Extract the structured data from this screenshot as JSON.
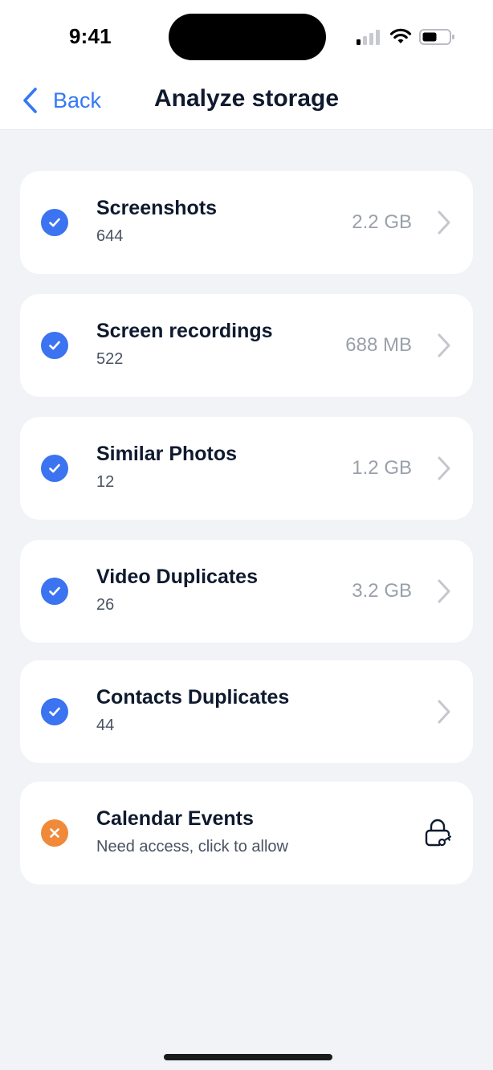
{
  "status_bar": {
    "time": "9:41"
  },
  "nav": {
    "back_label": "Back",
    "title": "Analyze storage"
  },
  "colors": {
    "accent": "#3478f6",
    "check": "#3b73f0",
    "warning": "#f08a3a"
  },
  "items": [
    {
      "title": "Screenshots",
      "subtitle": "644",
      "size": "2.2 GB",
      "status": "check",
      "trailing": "chevron-right-icon"
    },
    {
      "title": "Screen recordings",
      "subtitle": "522",
      "size": "688 MB",
      "status": "check",
      "trailing": "chevron-right-icon"
    },
    {
      "title": "Similar Photos",
      "subtitle": "12",
      "size": "1.2 GB",
      "status": "check",
      "trailing": "chevron-right-icon"
    },
    {
      "title": "Video Duplicates",
      "subtitle": "26",
      "size": "3.2 GB",
      "status": "check",
      "trailing": "chevron-right-icon"
    },
    {
      "title": "Contacts Duplicates",
      "subtitle": "44",
      "size": "",
      "status": "check",
      "trailing": "chevron-right-icon"
    },
    {
      "title": "Calendar Events",
      "subtitle": "Need access, click to allow",
      "size": "",
      "status": "error",
      "trailing": "lock-key-icon"
    }
  ]
}
